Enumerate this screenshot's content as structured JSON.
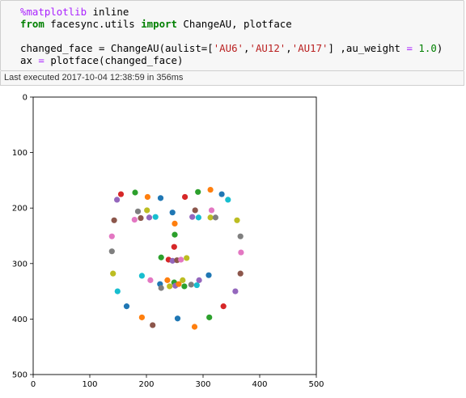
{
  "code": {
    "line1": {
      "magic": "%matplotlib",
      "rest": " inline"
    },
    "line2": {
      "kw1": "from",
      "mid1": " facesync.utils ",
      "kw2": "import",
      "rest": " ChangeAU, plotface"
    },
    "line3": "",
    "line4": {
      "p1": "changed_face = ChangeAU(aulist=[",
      "s1": "'AU6'",
      "c1": ",",
      "s2": "'AU12'",
      "c2": ",",
      "s3": "'AU17'",
      "p2": "] ,au_weight ",
      "op": "=",
      "sp": " ",
      "num": "1.0",
      "p3": ")"
    },
    "line5": {
      "p1": "ax ",
      "op": "=",
      "p2": " plotface(changed_face)"
    }
  },
  "exec_status": "Last executed 2017-10-04 12:38:59 in 356ms",
  "chart_data": {
    "type": "scatter",
    "xlim": [
      0,
      500
    ],
    "ylim": [
      500,
      0
    ],
    "xticks": [
      "0",
      "100",
      "200",
      "300",
      "400",
      "500"
    ],
    "yticks": [
      "0",
      "100",
      "200",
      "300",
      "400",
      "500"
    ],
    "points": [
      {
        "x": 148,
        "y": 185,
        "color": "#9467bd"
      },
      {
        "x": 155,
        "y": 175,
        "color": "#d62728"
      },
      {
        "x": 180,
        "y": 172,
        "color": "#2ca02c"
      },
      {
        "x": 202,
        "y": 180,
        "color": "#ff7f0e"
      },
      {
        "x": 225,
        "y": 182,
        "color": "#1f77b4"
      },
      {
        "x": 268,
        "y": 180,
        "color": "#d62728"
      },
      {
        "x": 291,
        "y": 171,
        "color": "#2ca02c"
      },
      {
        "x": 313,
        "y": 167,
        "color": "#ff7f0e"
      },
      {
        "x": 333,
        "y": 175,
        "color": "#1f77b4"
      },
      {
        "x": 344,
        "y": 185,
        "color": "#17becf"
      },
      {
        "x": 143,
        "y": 222,
        "color": "#8c564b"
      },
      {
        "x": 139,
        "y": 251,
        "color": "#e377c2"
      },
      {
        "x": 139,
        "y": 278,
        "color": "#7f7f7f"
      },
      {
        "x": 141,
        "y": 318,
        "color": "#bcbd22"
      },
      {
        "x": 149,
        "y": 350,
        "color": "#17becf"
      },
      {
        "x": 165,
        "y": 377,
        "color": "#1f77b4"
      },
      {
        "x": 192,
        "y": 397,
        "color": "#ff7f0e"
      },
      {
        "x": 211,
        "y": 411,
        "color": "#8c564b"
      },
      {
        "x": 255,
        "y": 399,
        "color": "#1f77b4"
      },
      {
        "x": 285,
        "y": 414,
        "color": "#ff7f0e"
      },
      {
        "x": 311,
        "y": 397,
        "color": "#2ca02c"
      },
      {
        "x": 336,
        "y": 377,
        "color": "#d62728"
      },
      {
        "x": 357,
        "y": 350,
        "color": "#9467bd"
      },
      {
        "x": 366,
        "y": 318,
        "color": "#8c564b"
      },
      {
        "x": 367,
        "y": 280,
        "color": "#e377c2"
      },
      {
        "x": 366,
        "y": 251,
        "color": "#7f7f7f"
      },
      {
        "x": 360,
        "y": 222,
        "color": "#bcbd22"
      },
      {
        "x": 179,
        "y": 221,
        "color": "#e377c2"
      },
      {
        "x": 185,
        "y": 206,
        "color": "#7f7f7f"
      },
      {
        "x": 190,
        "y": 218,
        "color": "#8c564b"
      },
      {
        "x": 201,
        "y": 204,
        "color": "#bcbd22"
      },
      {
        "x": 205,
        "y": 217,
        "color": "#9467bd"
      },
      {
        "x": 216,
        "y": 216,
        "color": "#17becf"
      },
      {
        "x": 246,
        "y": 208,
        "color": "#1f77b4"
      },
      {
        "x": 250,
        "y": 228,
        "color": "#ff7f0e"
      },
      {
        "x": 250,
        "y": 248,
        "color": "#2ca02c"
      },
      {
        "x": 249,
        "y": 270,
        "color": "#d62728"
      },
      {
        "x": 281,
        "y": 216,
        "color": "#9467bd"
      },
      {
        "x": 286,
        "y": 204,
        "color": "#8c564b"
      },
      {
        "x": 292,
        "y": 217,
        "color": "#17becf"
      },
      {
        "x": 313,
        "y": 217,
        "color": "#bcbd22"
      },
      {
        "x": 315,
        "y": 204,
        "color": "#e377c2"
      },
      {
        "x": 322,
        "y": 217,
        "color": "#7f7f7f"
      },
      {
        "x": 226,
        "y": 289,
        "color": "#2ca02c"
      },
      {
        "x": 239,
        "y": 293,
        "color": "#d62728"
      },
      {
        "x": 246,
        "y": 295,
        "color": "#9467bd"
      },
      {
        "x": 254,
        "y": 294,
        "color": "#8c564b"
      },
      {
        "x": 261,
        "y": 293,
        "color": "#e377c2"
      },
      {
        "x": 271,
        "y": 290,
        "color": "#bcbd22"
      },
      {
        "x": 192,
        "y": 322,
        "color": "#17becf"
      },
      {
        "x": 207,
        "y": 330,
        "color": "#e377c2"
      },
      {
        "x": 224,
        "y": 337,
        "color": "#1f77b4"
      },
      {
        "x": 226,
        "y": 344,
        "color": "#7f7f7f"
      },
      {
        "x": 237,
        "y": 330,
        "color": "#ff7f0e"
      },
      {
        "x": 241,
        "y": 341,
        "color": "#bcbd22"
      },
      {
        "x": 249,
        "y": 334,
        "color": "#2ca02c"
      },
      {
        "x": 251,
        "y": 340,
        "color": "#9467bd"
      },
      {
        "x": 257,
        "y": 337,
        "color": "#ff7f0e"
      },
      {
        "x": 264,
        "y": 330,
        "color": "#bcbd22"
      },
      {
        "x": 267,
        "y": 341,
        "color": "#2ca02c"
      },
      {
        "x": 279,
        "y": 338,
        "color": "#7f7f7f"
      },
      {
        "x": 289,
        "y": 339,
        "color": "#17becf"
      },
      {
        "x": 293,
        "y": 330,
        "color": "#9467bd"
      },
      {
        "x": 310,
        "y": 321,
        "color": "#1f77b4"
      }
    ]
  }
}
